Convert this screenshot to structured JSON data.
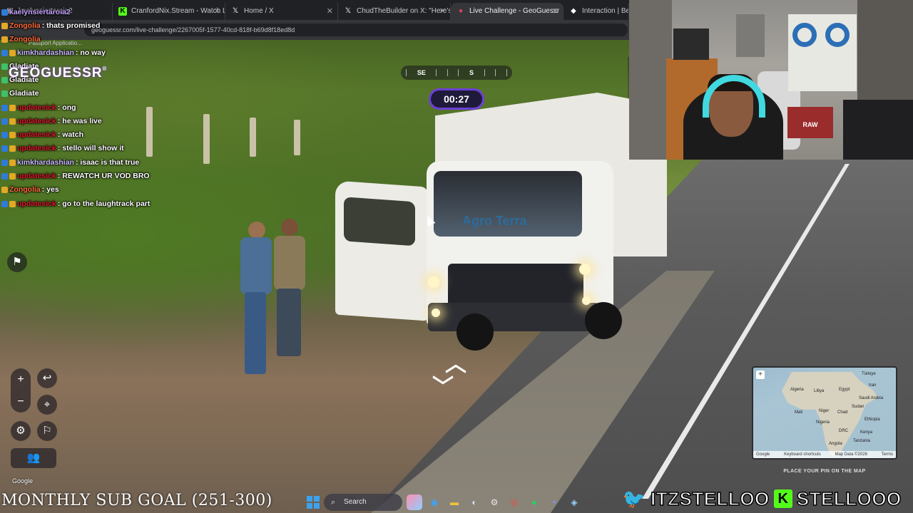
{
  "browser": {
    "tabs": [
      {
        "label": "kaelynsiertaroia2",
        "icon": "app-icon",
        "active": false
      },
      {
        "label": "CranfordNix.Stream - Watch Li...",
        "icon": "kick-icon",
        "active": false
      },
      {
        "label": "Home / X",
        "icon": "x-icon",
        "active": false
      },
      {
        "label": "ChudTheBuilder on X: \"Here's...\"",
        "icon": "x-icon",
        "active": false
      },
      {
        "label": "Live Challenge - GeoGuessr",
        "icon": "pin-icon",
        "active": true
      },
      {
        "label": "Interaction | Beth",
        "icon": "app-icon",
        "active": false
      }
    ],
    "url": "geoguessr.com/live-challenge/2267005f-1577-40cd-818f-b69d8f18ed8d",
    "bookmark": "Passport Applicatio..."
  },
  "chat": [
    {
      "user": "kaelynsiertaroia2",
      "text": "",
      "color": "#c3a3ff",
      "badges": [
        "blue"
      ]
    },
    {
      "user": "Zongolia",
      "text": "thats promised",
      "color": "#ff6a3a",
      "badges": [
        "gold"
      ]
    },
    {
      "user": "Zongolia",
      "text": "",
      "color": "#ff6a3a",
      "badges": [
        "gold"
      ]
    },
    {
      "user": "kimkhardashian",
      "text": "no way",
      "color": "#c9b6ff",
      "badges": [
        "blue",
        "gold"
      ]
    },
    {
      "user": "Gladiate",
      "text": "",
      "color": "#ffffff",
      "badges": [
        "green"
      ]
    },
    {
      "user": "Gladiate",
      "text": "",
      "color": "#ffffff",
      "badges": [
        "green"
      ]
    },
    {
      "user": "Gladiate",
      "text": "",
      "color": "#ffffff",
      "badges": [
        "green"
      ]
    },
    {
      "user": "updatesick",
      "text": "ong",
      "color": "#e0162b",
      "badges": [
        "blue",
        "gold"
      ]
    },
    {
      "user": "updatesick",
      "text": "he was live",
      "color": "#e0162b",
      "badges": [
        "blue",
        "gold"
      ]
    },
    {
      "user": "updatesick",
      "text": "watch",
      "color": "#e0162b",
      "badges": [
        "blue",
        "gold"
      ]
    },
    {
      "user": "updatesick",
      "text": "stello will show it",
      "color": "#e0162b",
      "badges": [
        "blue",
        "gold"
      ]
    },
    {
      "user": "kimkhardashian",
      "text": "isaac is that true",
      "color": "#c9b6ff",
      "badges": [
        "blue",
        "gold"
      ]
    },
    {
      "user": "updatesick",
      "text": "REWATCH UR VOD BRO",
      "color": "#e0162b",
      "badges": [
        "blue",
        "gold"
      ]
    },
    {
      "user": "Zongolia",
      "text": "yes",
      "color": "#ff6a3a",
      "badges": [
        "gold"
      ]
    },
    {
      "user": "updatesick",
      "text": "go to the laughtrack part",
      "color": "#e0162b",
      "badges": [
        "blue",
        "gold"
      ]
    }
  ],
  "game": {
    "logo": "GEOGUESSR",
    "timer": "00:27",
    "compass": [
      "SE",
      "S"
    ],
    "google": "Google",
    "truck_logo": "Agro Terra",
    "minimap": {
      "labels": [
        "Türkiye",
        "Iran",
        "Algeria",
        "Libya",
        "Egypt",
        "Saudi Arabia",
        "Mali",
        "Niger",
        "Chad",
        "Sudan",
        "Nigeria",
        "Ethiopia",
        "DRC",
        "Kenya",
        "Tanzania",
        "Angola"
      ],
      "footer": [
        "Keyboard shortcuts",
        "Map Data ©2026",
        "Terms"
      ],
      "google": "Google",
      "hint": "PLACE YOUR PIN ON THE MAP"
    }
  },
  "stream": {
    "goal": "MONTHLY SUB GOAL (251-300)",
    "twitter": "ITZSTELLOO",
    "kick": "STELLOOO",
    "poster_brand": "RAW"
  },
  "taskbar": {
    "search": "Search"
  },
  "colors": {
    "timer_border": "#6d3fd6",
    "kick_green": "#53fc18",
    "twitter_blue": "#1da1f2"
  }
}
